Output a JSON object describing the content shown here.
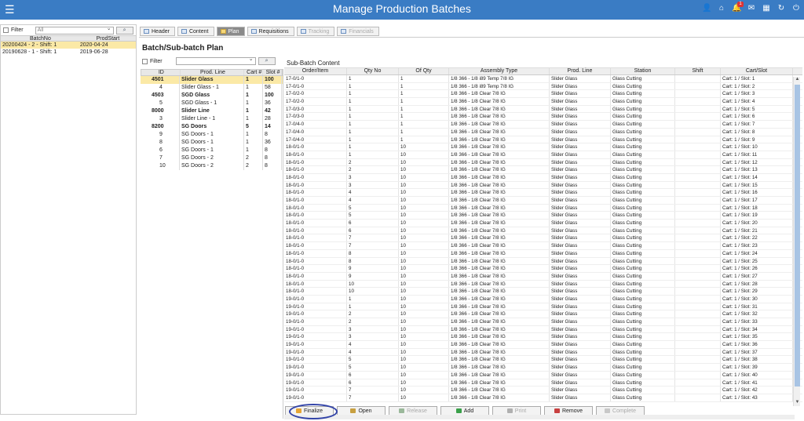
{
  "header": {
    "title": "Manage Production Batches",
    "menu_icon": "menu-icon",
    "notification_count": "1"
  },
  "left": {
    "filter_label": "Filter",
    "filter_select": "All",
    "columns": [
      "BatchNo",
      "ProdStart"
    ],
    "rows": [
      {
        "batch": "20200424 - 2 - Shift: 1",
        "start": "2020-04-24",
        "selected": true
      },
      {
        "batch": "20190628 - 1 - Shift: 1",
        "start": "2019-06-28",
        "selected": false
      }
    ]
  },
  "tabs": [
    {
      "label": "Header",
      "state": "normal"
    },
    {
      "label": "Content",
      "state": "normal"
    },
    {
      "label": "Plan",
      "state": "active"
    },
    {
      "label": "Requisitions",
      "state": "normal"
    },
    {
      "label": "Tracking",
      "state": "disabled"
    },
    {
      "label": "Financials",
      "state": "disabled"
    }
  ],
  "plan": {
    "title": "Batch/Sub-batch Plan",
    "filter_label": "Filter",
    "columns": [
      "ID",
      "Prod. Line",
      "Cart #",
      "Slot #"
    ],
    "rows": [
      {
        "id": "4501",
        "line": "Slider Glass",
        "cart": "1",
        "slot": "100",
        "parent": true,
        "highlight": true
      },
      {
        "id": "4",
        "line": "Slider Glass - 1",
        "cart": "1",
        "slot": "58",
        "parent": false
      },
      {
        "id": "4503",
        "line": "SGD Glass",
        "cart": "1",
        "slot": "100",
        "parent": true
      },
      {
        "id": "5",
        "line": "SGD Glass - 1",
        "cart": "1",
        "slot": "36",
        "parent": false
      },
      {
        "id": "8000",
        "line": "Slider Line",
        "cart": "1",
        "slot": "42",
        "parent": true
      },
      {
        "id": "3",
        "line": "Slider Line - 1",
        "cart": "1",
        "slot": "28",
        "parent": false
      },
      {
        "id": "8200",
        "line": "SG Doors",
        "cart": "5",
        "slot": "14",
        "parent": true
      },
      {
        "id": "9",
        "line": "SG Doors - 1",
        "cart": "1",
        "slot": "8",
        "parent": false
      },
      {
        "id": "8",
        "line": "SG Doors - 1",
        "cart": "1",
        "slot": "36",
        "parent": false
      },
      {
        "id": "6",
        "line": "SG Doors - 1",
        "cart": "1",
        "slot": "8",
        "parent": false
      },
      {
        "id": "7",
        "line": "SG Doors - 2",
        "cart": "2",
        "slot": "8",
        "parent": false
      },
      {
        "id": "10",
        "line": "SG Doors - 2",
        "cart": "2",
        "slot": "8",
        "parent": false
      }
    ]
  },
  "sub": {
    "title": "Sub-Batch Content",
    "columns": [
      "Order/Item",
      "Qty No",
      "Of Qty",
      "Assembly Type",
      "Prod. Line",
      "Station",
      "Shift",
      "Cart/Slot"
    ],
    "rows": [
      [
        "17-0/1-0",
        "1",
        "1",
        "1/8 366 - 1/8 i89 Temp 7/8 IG",
        "Slider Glass",
        "Glass Cutting",
        "",
        "Cart: 1 / Slot: 1"
      ],
      [
        "17-0/1-0",
        "1",
        "1",
        "1/8 366 - 1/8 i89 Temp 7/8 IG",
        "Slider Glass",
        "Glass Cutting",
        "",
        "Cart: 1 / Slot: 2"
      ],
      [
        "17-0/2-0",
        "1",
        "1",
        "1/8 366 - 1/8 Clear 7/8 IG",
        "Slider Glass",
        "Glass Cutting",
        "",
        "Cart: 1 / Slot: 3"
      ],
      [
        "17-0/2-0",
        "1",
        "1",
        "1/8 366 - 1/8 Clear 7/8 IG",
        "Slider Glass",
        "Glass Cutting",
        "",
        "Cart: 1 / Slot: 4"
      ],
      [
        "17-0/3-0",
        "1",
        "1",
        "1/8 366 - 1/8 Clear 7/8 IG",
        "Slider Glass",
        "Glass Cutting",
        "",
        "Cart: 1 / Slot: 5"
      ],
      [
        "17-0/3-0",
        "1",
        "1",
        "1/8 366 - 1/8 Clear 7/8 IG",
        "Slider Glass",
        "Glass Cutting",
        "",
        "Cart: 1 / Slot: 6"
      ],
      [
        "17-0/4-0",
        "1",
        "1",
        "1/8 366 - 1/8 Clear 7/8 IG",
        "Slider Glass",
        "Glass Cutting",
        "",
        "Cart: 1 / Slot: 7"
      ],
      [
        "17-0/4-0",
        "1",
        "1",
        "1/8 366 - 1/8 Clear 7/8 IG",
        "Slider Glass",
        "Glass Cutting",
        "",
        "Cart: 1 / Slot: 8"
      ],
      [
        "17-0/4-0",
        "1",
        "1",
        "1/8 366 - 1/8 Clear 7/8 IG",
        "Slider Glass",
        "Glass Cutting",
        "",
        "Cart: 1 / Slot: 9"
      ],
      [
        "18-0/1-0",
        "1",
        "10",
        "1/8 366 - 1/8 Clear 7/8 IG",
        "Slider Glass",
        "Glass Cutting",
        "",
        "Cart: 1 / Slot: 10"
      ],
      [
        "18-0/1-0",
        "1",
        "10",
        "1/8 366 - 1/8 Clear 7/8 IG",
        "Slider Glass",
        "Glass Cutting",
        "",
        "Cart: 1 / Slot: 11"
      ],
      [
        "18-0/1-0",
        "2",
        "10",
        "1/8 366 - 1/8 Clear 7/8 IG",
        "Slider Glass",
        "Glass Cutting",
        "",
        "Cart: 1 / Slot: 12"
      ],
      [
        "18-0/1-0",
        "2",
        "10",
        "1/8 366 - 1/8 Clear 7/8 IG",
        "Slider Glass",
        "Glass Cutting",
        "",
        "Cart: 1 / Slot: 13"
      ],
      [
        "18-0/1-0",
        "3",
        "10",
        "1/8 366 - 1/8 Clear 7/8 IG",
        "Slider Glass",
        "Glass Cutting",
        "",
        "Cart: 1 / Slot: 14"
      ],
      [
        "18-0/1-0",
        "3",
        "10",
        "1/8 366 - 1/8 Clear 7/8 IG",
        "Slider Glass",
        "Glass Cutting",
        "",
        "Cart: 1 / Slot: 15"
      ],
      [
        "18-0/1-0",
        "4",
        "10",
        "1/8 366 - 1/8 Clear 7/8 IG",
        "Slider Glass",
        "Glass Cutting",
        "",
        "Cart: 1 / Slot: 16"
      ],
      [
        "18-0/1-0",
        "4",
        "10",
        "1/8 366 - 1/8 Clear 7/8 IG",
        "Slider Glass",
        "Glass Cutting",
        "",
        "Cart: 1 / Slot: 17"
      ],
      [
        "18-0/1-0",
        "5",
        "10",
        "1/8 366 - 1/8 Clear 7/8 IG",
        "Slider Glass",
        "Glass Cutting",
        "",
        "Cart: 1 / Slot: 18"
      ],
      [
        "18-0/1-0",
        "5",
        "10",
        "1/8 366 - 1/8 Clear 7/8 IG",
        "Slider Glass",
        "Glass Cutting",
        "",
        "Cart: 1 / Slot: 19"
      ],
      [
        "18-0/1-0",
        "6",
        "10",
        "1/8 366 - 1/8 Clear 7/8 IG",
        "Slider Glass",
        "Glass Cutting",
        "",
        "Cart: 1 / Slot: 20"
      ],
      [
        "18-0/1-0",
        "6",
        "10",
        "1/8 366 - 1/8 Clear 7/8 IG",
        "Slider Glass",
        "Glass Cutting",
        "",
        "Cart: 1 / Slot: 21"
      ],
      [
        "18-0/1-0",
        "7",
        "10",
        "1/8 366 - 1/8 Clear 7/8 IG",
        "Slider Glass",
        "Glass Cutting",
        "",
        "Cart: 1 / Slot: 22"
      ],
      [
        "18-0/1-0",
        "7",
        "10",
        "1/8 366 - 1/8 Clear 7/8 IG",
        "Slider Glass",
        "Glass Cutting",
        "",
        "Cart: 1 / Slot: 23"
      ],
      [
        "18-0/1-0",
        "8",
        "10",
        "1/8 366 - 1/8 Clear 7/8 IG",
        "Slider Glass",
        "Glass Cutting",
        "",
        "Cart: 1 / Slot: 24"
      ],
      [
        "18-0/1-0",
        "8",
        "10",
        "1/8 366 - 1/8 Clear 7/8 IG",
        "Slider Glass",
        "Glass Cutting",
        "",
        "Cart: 1 / Slot: 25"
      ],
      [
        "18-0/1-0",
        "9",
        "10",
        "1/8 366 - 1/8 Clear 7/8 IG",
        "Slider Glass",
        "Glass Cutting",
        "",
        "Cart: 1 / Slot: 26"
      ],
      [
        "18-0/1-0",
        "9",
        "10",
        "1/8 366 - 1/8 Clear 7/8 IG",
        "Slider Glass",
        "Glass Cutting",
        "",
        "Cart: 1 / Slot: 27"
      ],
      [
        "18-0/1-0",
        "10",
        "10",
        "1/8 366 - 1/8 Clear 7/8 IG",
        "Slider Glass",
        "Glass Cutting",
        "",
        "Cart: 1 / Slot: 28"
      ],
      [
        "18-0/1-0",
        "10",
        "10",
        "1/8 366 - 1/8 Clear 7/8 IG",
        "Slider Glass",
        "Glass Cutting",
        "",
        "Cart: 1 / Slot: 29"
      ],
      [
        "19-0/1-0",
        "1",
        "10",
        "1/8 366 - 1/8 Clear 7/8 IG",
        "Slider Glass",
        "Glass Cutting",
        "",
        "Cart: 1 / Slot: 30"
      ],
      [
        "19-0/1-0",
        "1",
        "10",
        "1/8 366 - 1/8 Clear 7/8 IG",
        "Slider Glass",
        "Glass Cutting",
        "",
        "Cart: 1 / Slot: 31"
      ],
      [
        "19-0/1-0",
        "2",
        "10",
        "1/8 366 - 1/8 Clear 7/8 IG",
        "Slider Glass",
        "Glass Cutting",
        "",
        "Cart: 1 / Slot: 32"
      ],
      [
        "19-0/1-0",
        "2",
        "10",
        "1/8 366 - 1/8 Clear 7/8 IG",
        "Slider Glass",
        "Glass Cutting",
        "",
        "Cart: 1 / Slot: 33"
      ],
      [
        "19-0/1-0",
        "3",
        "10",
        "1/8 366 - 1/8 Clear 7/8 IG",
        "Slider Glass",
        "Glass Cutting",
        "",
        "Cart: 1 / Slot: 34"
      ],
      [
        "19-0/1-0",
        "3",
        "10",
        "1/8 366 - 1/8 Clear 7/8 IG",
        "Slider Glass",
        "Glass Cutting",
        "",
        "Cart: 1 / Slot: 35"
      ],
      [
        "19-0/1-0",
        "4",
        "10",
        "1/8 366 - 1/8 Clear 7/8 IG",
        "Slider Glass",
        "Glass Cutting",
        "",
        "Cart: 1 / Slot: 36"
      ],
      [
        "19-0/1-0",
        "4",
        "10",
        "1/8 366 - 1/8 Clear 7/8 IG",
        "Slider Glass",
        "Glass Cutting",
        "",
        "Cart: 1 / Slot: 37"
      ],
      [
        "19-0/1-0",
        "5",
        "10",
        "1/8 366 - 1/8 Clear 7/8 IG",
        "Slider Glass",
        "Glass Cutting",
        "",
        "Cart: 1 / Slot: 38"
      ],
      [
        "19-0/1-0",
        "5",
        "10",
        "1/8 366 - 1/8 Clear 7/8 IG",
        "Slider Glass",
        "Glass Cutting",
        "",
        "Cart: 1 / Slot: 39"
      ],
      [
        "19-0/1-0",
        "6",
        "10",
        "1/8 366 - 1/8 Clear 7/8 IG",
        "Slider Glass",
        "Glass Cutting",
        "",
        "Cart: 1 / Slot: 40"
      ],
      [
        "19-0/1-0",
        "6",
        "10",
        "1/8 366 - 1/8 Clear 7/8 IG",
        "Slider Glass",
        "Glass Cutting",
        "",
        "Cart: 1 / Slot: 41"
      ],
      [
        "19-0/1-0",
        "7",
        "10",
        "1/8 366 - 1/8 Clear 7/8 IG",
        "Slider Glass",
        "Glass Cutting",
        "",
        "Cart: 1 / Slot: 42"
      ],
      [
        "19-0/1-0",
        "7",
        "10",
        "1/8 366 - 1/8 Clear 7/8 IG",
        "Slider Glass",
        "Glass Cutting",
        "",
        "Cart: 1 / Slot: 43"
      ]
    ]
  },
  "buttons": [
    {
      "label": "Finalize",
      "icon": "finalize-icon",
      "enabled": true
    },
    {
      "label": "Open",
      "icon": "open-icon",
      "enabled": true
    },
    {
      "label": "Release",
      "icon": "release-icon",
      "enabled": false
    },
    {
      "label": "Add",
      "icon": "add-icon",
      "enabled": true
    },
    {
      "label": "Print",
      "icon": "print-icon",
      "enabled": false
    },
    {
      "label": "Remove",
      "icon": "remove-icon",
      "enabled": true
    },
    {
      "label": "Complete",
      "icon": "complete-icon",
      "enabled": false
    }
  ],
  "colors": {
    "header": "#3a7cc4",
    "selected_row": "#fbe9a6",
    "highlight_ring": "#3344a8"
  }
}
